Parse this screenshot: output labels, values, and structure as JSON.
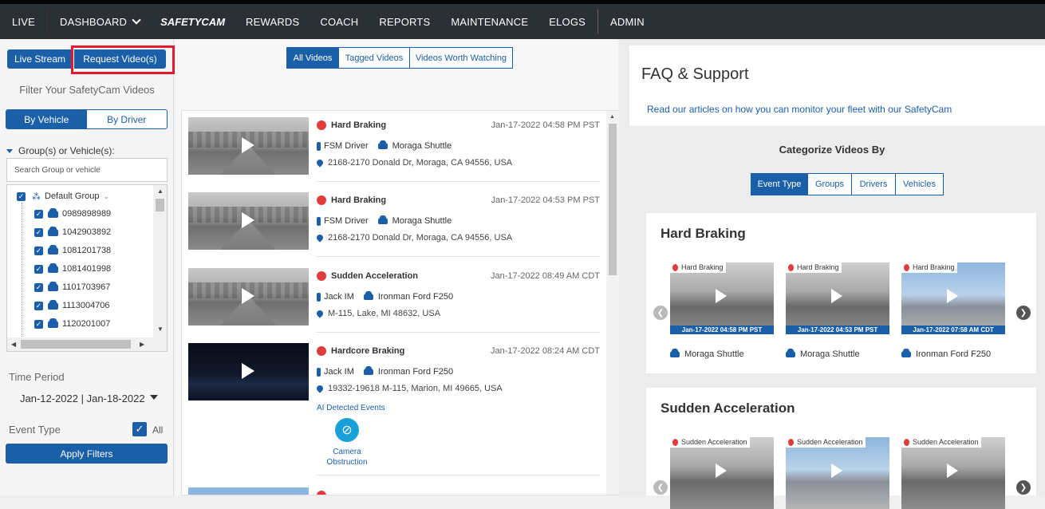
{
  "nav": {
    "items": [
      "LIVE",
      "DASHBOARD",
      "SAFETYCAM",
      "REWARDS",
      "COACH",
      "REPORTS",
      "MAINTENANCE",
      "ELOGS",
      "ADMIN"
    ]
  },
  "left": {
    "live_stream": "Live Stream",
    "request_videos": "Request Video(s)",
    "filter_title": "Filter Your SafetyCam Videos",
    "by_vehicle": "By Vehicle",
    "by_driver": "By Driver",
    "group_label": "Group(s) or Vehicle(s):",
    "search_placeholder": "Search Group or vehicle",
    "default_group": "Default Group",
    "vehicles": [
      "0989898989",
      "1042903892",
      "1081201738",
      "1081401998",
      "1101703967",
      "1113004706",
      "1120201007"
    ],
    "time_period_label": "Time Period",
    "date_range": "Jan-12-2022 | Jan-18-2022",
    "event_type_label": "Event Type",
    "all_label": "All",
    "apply": "Apply Filters"
  },
  "video_tabs": [
    "All Videos",
    "Tagged Videos",
    "Videos Worth Watching"
  ],
  "videos": [
    {
      "event": "Hard Braking",
      "date": "Jan-17-2022 04:58 PM PST",
      "driver": "FSM Driver",
      "vehicle": "Moraga Shuttle",
      "location": "2168-2170 Donald Dr, Moraga, CA 94556, USA",
      "night": false
    },
    {
      "event": "Hard Braking",
      "date": "Jan-17-2022 04:53 PM PST",
      "driver": "FSM Driver",
      "vehicle": "Moraga Shuttle",
      "location": "2168-2170 Donald Dr, Moraga, CA 94556, USA",
      "night": false
    },
    {
      "event": "Sudden Acceleration",
      "date": "Jan-17-2022 08:49 AM CDT",
      "driver": "Jack IM",
      "vehicle": "Ironman Ford F250",
      "location": "M-115, Lake, MI 48632, USA",
      "night": false
    },
    {
      "event": "Hardcore Braking",
      "date": "Jan-17-2022 08:24 AM CDT",
      "driver": "Jack IM",
      "vehicle": "Ironman Ford F250",
      "location": "19332-19618 M-115, Marion, MI 49665, USA",
      "night": true
    }
  ],
  "ai": {
    "label": "AI Detected Events",
    "event": "Camera Obstruction"
  },
  "faq": {
    "title": "FAQ & Support",
    "link": "Read our articles on how you can monitor your fleet with our SafetyCam"
  },
  "categorize": {
    "title": "Categorize Videos By",
    "tabs": [
      "Event Type",
      "Groups",
      "Drivers",
      "Vehicles"
    ]
  },
  "cards": [
    {
      "title": "Hard Braking",
      "clips": [
        {
          "tag": "Hard Braking",
          "date": "Jan-17-2022 04:58 PM PST",
          "vehicle": "Moraga Shuttle"
        },
        {
          "tag": "Hard Braking",
          "date": "Jan-17-2022 04:53 PM PST",
          "vehicle": "Moraga Shuttle"
        },
        {
          "tag": "Hard Braking",
          "date": "Jan-17-2022 07:58 AM CDT",
          "vehicle": "Ironman Ford F250"
        }
      ]
    },
    {
      "title": "Sudden Acceleration",
      "clips": [
        {
          "tag": "Sudden Acceleration"
        },
        {
          "tag": "Sudden Acceleration"
        },
        {
          "tag": "Sudden Acceleration"
        }
      ]
    }
  ],
  "colors": {
    "brand": "#1a5fa8",
    "nav_bg": "#2b2f36",
    "highlight": "#e8192c",
    "event_red": "#e23b3b"
  }
}
